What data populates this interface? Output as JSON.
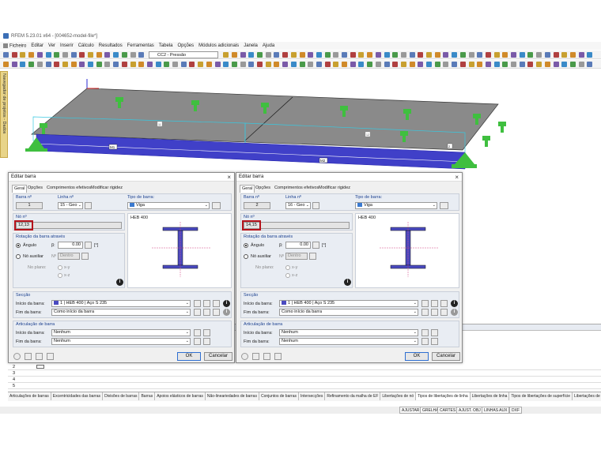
{
  "window": {
    "title": "RFEM 5.23.01 x64 - [004652-model-file*]"
  },
  "menu": [
    "Ficheiro",
    "Editar",
    "Ver",
    "Inserir",
    "Cálculo",
    "Resultados",
    "Ferramentas",
    "Tabela",
    "Opções",
    "Módulos adicionais",
    "Janela",
    "Ajuda"
  ],
  "toolbar": {
    "load_case": "CC2 - Pressão"
  },
  "navigator": {
    "label": "Navegador de projetos - Dados"
  },
  "viewport": {
    "member_labels": [
      "M1",
      "M2"
    ],
    "node_labels": [
      "11",
      "12",
      "2"
    ]
  },
  "dialogs": [
    {
      "title": "Editar barra",
      "tabs": [
        "Geral",
        "Opções",
        "Comprimentos efetivos",
        "Modificar rigidez"
      ],
      "member_no_label": "Barra nº",
      "member_no": "1",
      "line_no_label": "Linha nº",
      "line_no": "15 - Geo",
      "member_type_label": "Tipo de barra:",
      "member_type": "Viga",
      "node_no_label": "Nó nº",
      "node_no": "12,13",
      "rotation_label": "Rotação da barra através",
      "angle_label": "Ângulo",
      "beta_label": "β:",
      "beta_value": "0.00",
      "beta_unit": "[°]",
      "aux_node_label": "Nó auxiliar",
      "aux_no_label": "Nº",
      "aux_no_value": "Dentro",
      "plane_label": "No plano:",
      "plane_xy": "x-y",
      "plane_xz": "x-z",
      "section_name": "HEB 400",
      "section_group": "Secção",
      "section_start_label": "Início da barra:",
      "section_start_value": "1 | HEB 400 | Aço S 235",
      "section_end_label": "Fim da barra:",
      "section_end_value": "Como início da barra",
      "hinge_group": "Articulação de barra",
      "hinge_start_label": "Início da barra:",
      "hinge_start_value": "Nenhum",
      "hinge_end_label": "Fim da barra:",
      "hinge_end_value": "Nenhum",
      "ok": "OK",
      "cancel": "Cancelar"
    },
    {
      "title": "Editar barra",
      "tabs": [
        "Geral",
        "Opções",
        "Comprimentos efetivos",
        "Modificar rigidez"
      ],
      "member_no_label": "Barra nº",
      "member_no": "2",
      "line_no_label": "Linha nº",
      "line_no": "16 - Geo",
      "member_type_label": "Tipo de barra:",
      "member_type": "Viga",
      "node_no_label": "Nó nº",
      "node_no": "14,15",
      "rotation_label": "Rotação da barra através",
      "angle_label": "Ângulo",
      "beta_label": "β:",
      "beta_value": "0.00",
      "beta_unit": "[°]",
      "aux_node_label": "Nó auxiliar",
      "aux_no_label": "Nº",
      "aux_no_value": "Dentro",
      "plane_label": "No plano:",
      "plane_xy": "x-y",
      "plane_xz": "x-z",
      "section_name": "HEB 400",
      "section_group": "Secção",
      "section_start_label": "Início da barra:",
      "section_start_value": "1 | HEB 400 | Aço S 235",
      "section_end_label": "Fim da barra:",
      "section_end_value": "Como início da barra",
      "hinge_group": "Articulação de barra",
      "hinge_start_label": "Início da barra:",
      "hinge_start_value": "Nenhum",
      "hinge_end_label": "Fim da barra:",
      "hinge_end_value": "Nenhum",
      "ok": "OK",
      "cancel": "Cancelar"
    }
  ],
  "table": {
    "rows": [
      "2",
      "3",
      "4",
      "5"
    ]
  },
  "table_tabs": [
    "Articulações de barras",
    "Excentricidades das barras",
    "Divisões de barras",
    "Barras",
    "Apoios elásticos de barras",
    "Não-lineariedades de barras",
    "Conjuntos de barras",
    "Intersecções",
    "Refinamento da malha de EF",
    "Libertações de nó",
    "Tipos de libertações de linha",
    "Libertações de linha",
    "Tipos de libertações de superfície",
    "Libertações de superfície"
  ],
  "status": [
    "AJUSTAR",
    "GRELHA",
    "CARTES",
    "AJUST. OBJ",
    "LINHAS AUX",
    "DXF"
  ],
  "colors": {
    "accent_red": "#b5121b",
    "support_green": "#3fbf3f",
    "beam_blue": "#4040c8",
    "slab_gray": "#8a8a8a"
  }
}
